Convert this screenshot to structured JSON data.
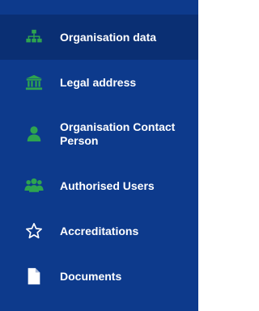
{
  "sidebar": {
    "items": [
      {
        "label": "Organisation data",
        "icon": "sitemap-icon",
        "active": true
      },
      {
        "label": "Legal address",
        "icon": "building-columns-icon",
        "active": false
      },
      {
        "label": "Organisation Contact Person",
        "icon": "person-icon",
        "active": false
      },
      {
        "label": "Authorised Users",
        "icon": "users-icon",
        "active": false
      },
      {
        "label": "Accreditations",
        "icon": "star-outline-icon",
        "active": false
      },
      {
        "label": "Documents",
        "icon": "document-icon",
        "active": false
      }
    ],
    "colors": {
      "background": "#0d3a8c",
      "active_background": "#0a2f73",
      "icon_green": "#2ea44f",
      "text": "#ffffff"
    }
  }
}
